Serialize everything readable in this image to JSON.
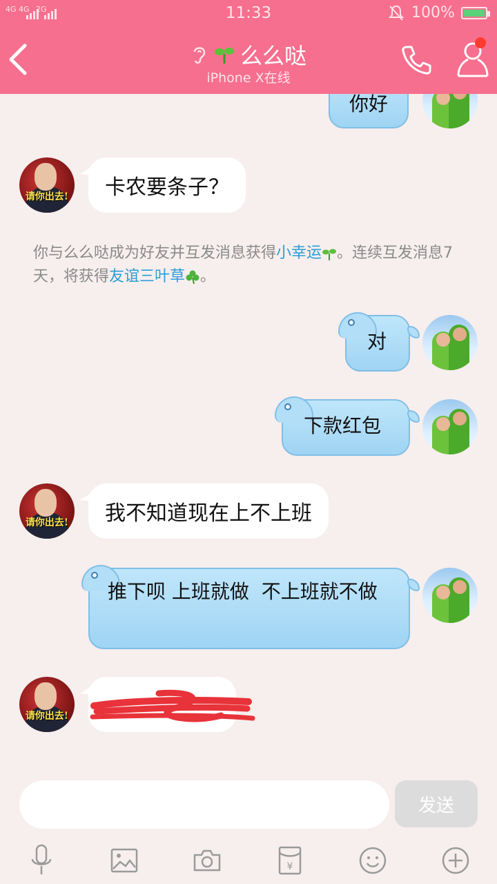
{
  "status_bar": {
    "network_top": "4G 4G",
    "network_2g": "2G",
    "time": "11:33",
    "battery": "100%",
    "battery_color": "#5bd17b"
  },
  "header": {
    "title": "么么哒",
    "subtitle": "iPhone X在线",
    "background_color": "#f76f8e",
    "icons": [
      "back-icon",
      "ear-icon",
      "sprout-icon",
      "phone-icon",
      "profile-icon"
    ]
  },
  "messages": [
    {
      "sender": "me",
      "text": "你好",
      "partially_visible": true
    },
    {
      "sender": "friend",
      "text": "卡农要条子？"
    },
    {
      "sender": "me",
      "text": "对"
    },
    {
      "sender": "me",
      "text": "下款红包"
    },
    {
      "sender": "friend",
      "text": "我不知道现在上不上班"
    },
    {
      "sender": "me",
      "text": "推下呗 上班就做  不上班就不做"
    },
    {
      "sender": "friend",
      "text": "",
      "redacted": true
    }
  ],
  "friend_avatar_text": "请你出去!",
  "system_note": {
    "prefix": "你与么么哒成为好友并互发消息获得",
    "link1": "小幸运",
    "middle": "。连续互发消息7天，将获得",
    "link2": "友谊三叶草",
    "suffix": "。"
  },
  "composer": {
    "input_value": "",
    "input_placeholder": "",
    "send_label": "发送",
    "tools": [
      "microphone-icon",
      "image-icon",
      "camera-icon",
      "red-packet-icon",
      "emoji-icon",
      "plus-icon"
    ]
  },
  "colors": {
    "chat_background": "#f7eeee",
    "incoming_bubble": "#ffffff",
    "outgoing_bubble": "#a8d8f5",
    "link": "#2a9fd8",
    "redaction": "#e8333a"
  }
}
